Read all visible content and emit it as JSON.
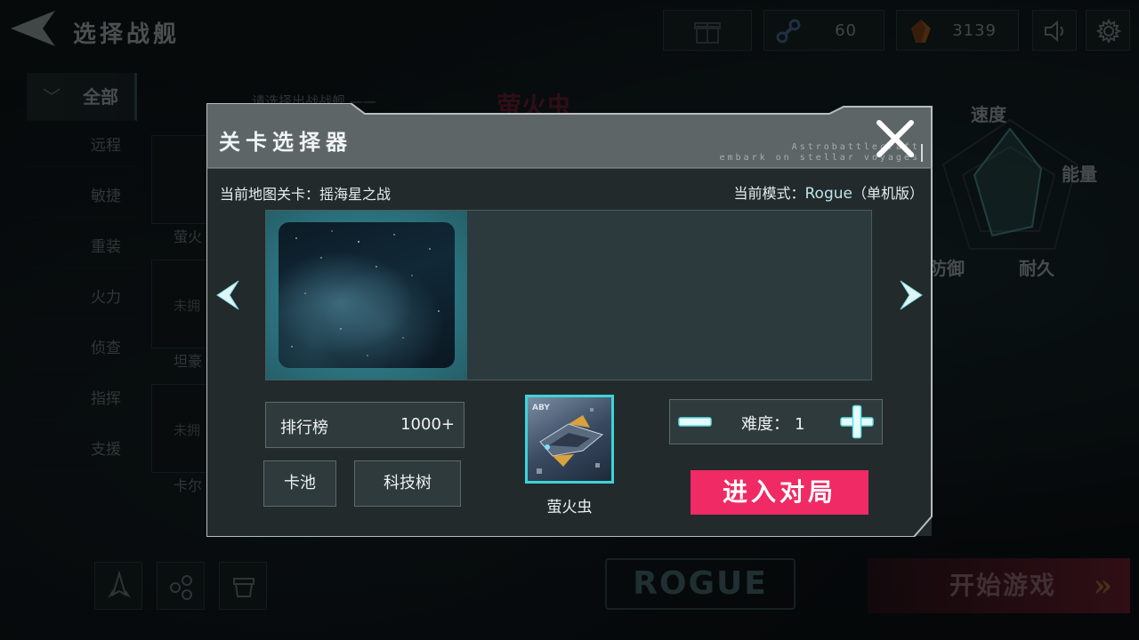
{
  "header": {
    "title": "选择战舰",
    "parts_count": "60",
    "crystal_count": "3139"
  },
  "sidebar": {
    "categories": [
      "全部",
      "远程",
      "敏捷",
      "重装",
      "火力",
      "侦查",
      "指挥",
      "支援"
    ]
  },
  "background": {
    "prompt": "请选择出战战舰 ——",
    "selected_ship": "萤火虫",
    "ship_cards": [
      {
        "label": "萤火",
        "owned": ""
      },
      {
        "label": "坦豪",
        "owned": "未拥"
      },
      {
        "label": "卡尔",
        "owned": "未拥"
      }
    ],
    "stats": [
      "速度",
      "能量",
      "防御",
      "耐久"
    ],
    "mode_tag": "ROGUE",
    "start_label": "开始游戏"
  },
  "dialog": {
    "title": "关卡选择器",
    "tagline_line1": "Astrobattlecraft",
    "tagline_line2": "embark on stellar voyages",
    "current_level_label": "当前地图关卡：",
    "current_level": "摇海星之战",
    "current_mode_label": "当前模式：",
    "current_mode": "Rogue",
    "mode_suffix": "（单机版）",
    "leaderboard_label": "排行榜",
    "leaderboard_rank": "1000+",
    "card_pool_label": "卡池",
    "tech_tree_label": "科技树",
    "ship_name": "萤火虫",
    "difficulty_label": "难度：",
    "difficulty_value": "1",
    "enter_label": "进入对局"
  },
  "colors": {
    "accent_cyan": "#3fd3d6",
    "enter_pink": "#ef2a64",
    "panel_gray": "#2e3a3c"
  },
  "icons": [
    "back-arrow-icon",
    "gift-icon",
    "parts-icon",
    "crystal-icon",
    "sound-icon",
    "gear-icon",
    "close-icon",
    "chevron-left-icon",
    "chevron-right-icon",
    "minus-icon",
    "plus-icon",
    "ship-icon",
    "share-icon",
    "storage-icon"
  ]
}
